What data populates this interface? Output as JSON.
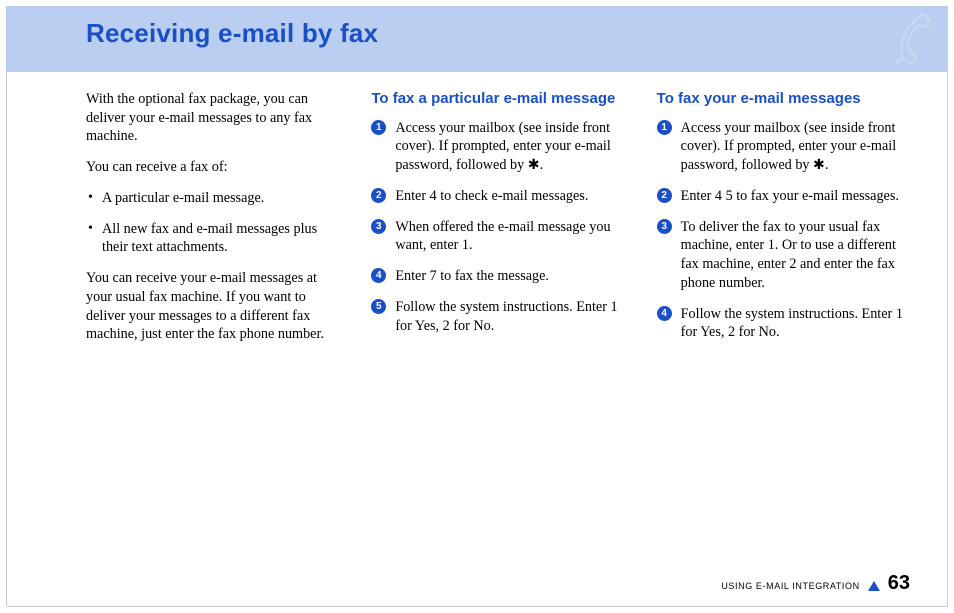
{
  "header": {
    "title": "Receiving e-mail by fax",
    "icon": "phone-handset"
  },
  "columnA": {
    "p1": "With the optional fax package, you can deliver your e-mail messages to any fax machine.",
    "p2": "You can receive a fax of:",
    "bullets": [
      "A particular e-mail message.",
      "All new fax and e-mail messages plus their text attachments."
    ],
    "p3": "You can receive your e-mail messages at your usual fax machine. If you want to deliver your messages to a different fax machine, just enter the fax phone number."
  },
  "columnB": {
    "heading": "To fax a particular e-mail message",
    "steps": [
      "Access your mailbox (see inside front cover). If prompted, enter your e-mail password, followed by ✱.",
      "Enter 4 to check e-mail messages.",
      "When offered the e-mail message you want, enter 1.",
      "Enter 7 to fax the message.",
      "Follow the system instructions. Enter 1 for Yes, 2 for No."
    ]
  },
  "columnC": {
    "heading": "To fax your e-mail messages",
    "steps": [
      "Access your mailbox (see inside front cover). If prompted, enter your e-mail password, followed by ✱.",
      "Enter 4 5 to fax your e-mail messages.",
      "To deliver the fax to your usual fax machine, enter 1. Or to use a different fax machine, enter 2 and enter the fax phone number.",
      "Follow the system instructions. Enter 1 for Yes, 2 for No."
    ]
  },
  "footer": {
    "section": "USING E-MAIL INTEGRATION",
    "page": "63"
  }
}
